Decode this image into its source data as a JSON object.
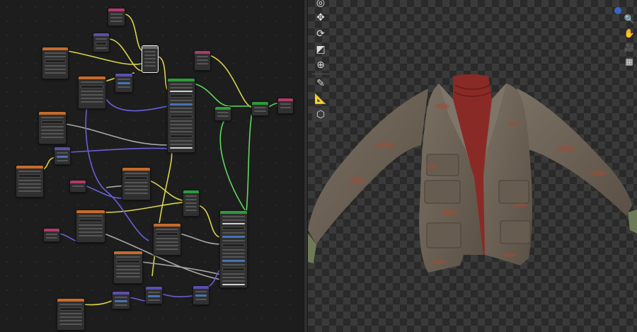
{
  "app": "3D shader node editor with viewport",
  "colors": {
    "wire_yellow": "#d9d44a",
    "wire_grey": "#a0a0a0",
    "wire_blue": "#6a5fd8",
    "wire_green": "#5ed95e",
    "header_orange": "#c76a2b",
    "header_teal": "#2b8a7d",
    "header_green": "#2f9a3a",
    "header_purple": "#5a4fb0",
    "header_pink": "#b03a6a",
    "header_dark": "#6a6a6a"
  },
  "toolbar": {
    "tools": [
      {
        "icon": "cursor-icon"
      },
      {
        "icon": "move-icon"
      },
      {
        "icon": "rotate-icon"
      },
      {
        "icon": "scale-icon"
      },
      {
        "icon": "transform-icon"
      },
      {
        "icon": "annotate-icon"
      },
      {
        "icon": "measure-icon"
      },
      {
        "icon": "add-cube-icon"
      }
    ]
  },
  "navigation": {
    "gizmo": "axis-gizmo-icon",
    "buttons": [
      "zoom-icon",
      "hand-pan-icon",
      "camera-icon",
      "grid-view-icon"
    ]
  },
  "viewport": {
    "background": "transparent-checkerboard",
    "object": "jacket-over-turtleneck-model"
  }
}
